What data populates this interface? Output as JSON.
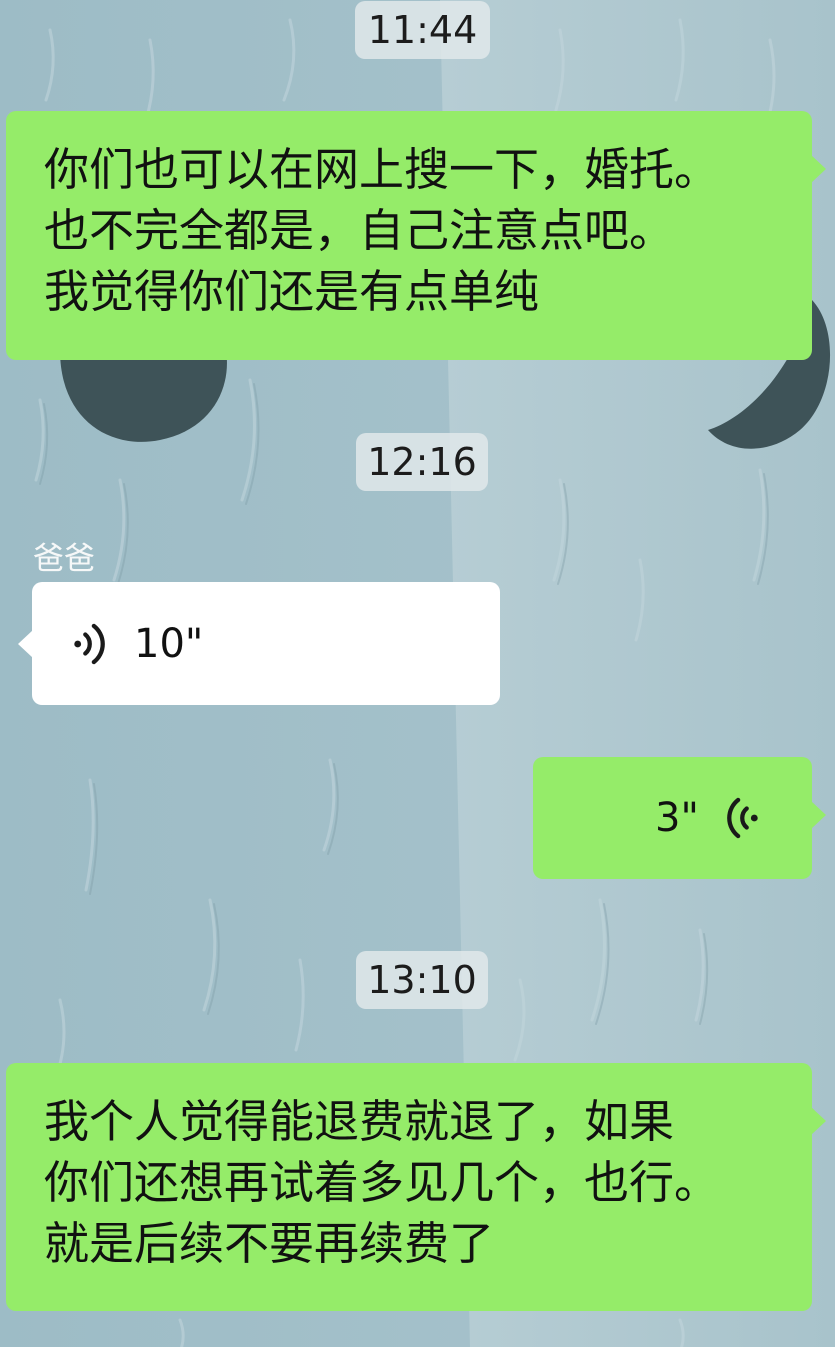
{
  "timestamps": [
    "11:44",
    "12:16",
    "13:10"
  ],
  "messages": [
    {
      "side": "right",
      "type": "text",
      "lines": [
        "你们也可以在网上搜一下，婚托。",
        "也不完全都是，自己注意点吧。",
        "我觉得你们还是有点单纯"
      ]
    },
    {
      "side": "left",
      "type": "voice",
      "sender": "爸爸",
      "duration": "10\""
    },
    {
      "side": "right",
      "type": "voice",
      "duration": "3\""
    },
    {
      "side": "right",
      "type": "text",
      "lines": [
        "我个人觉得能退费就退了，如果",
        "你们还想再试着多见几个，也行。",
        "就是后续不要再续费了"
      ]
    }
  ],
  "icons": {
    "incoming_voice": "voice-wave-right-icon",
    "outgoing_voice": "voice-wave-left-icon"
  },
  "colors": {
    "outgoing_bubble": "#95ec69",
    "incoming_bubble": "#ffffff",
    "timestamp_pill": "#e0e8ea",
    "wallpaper": "#a3c1c9"
  }
}
